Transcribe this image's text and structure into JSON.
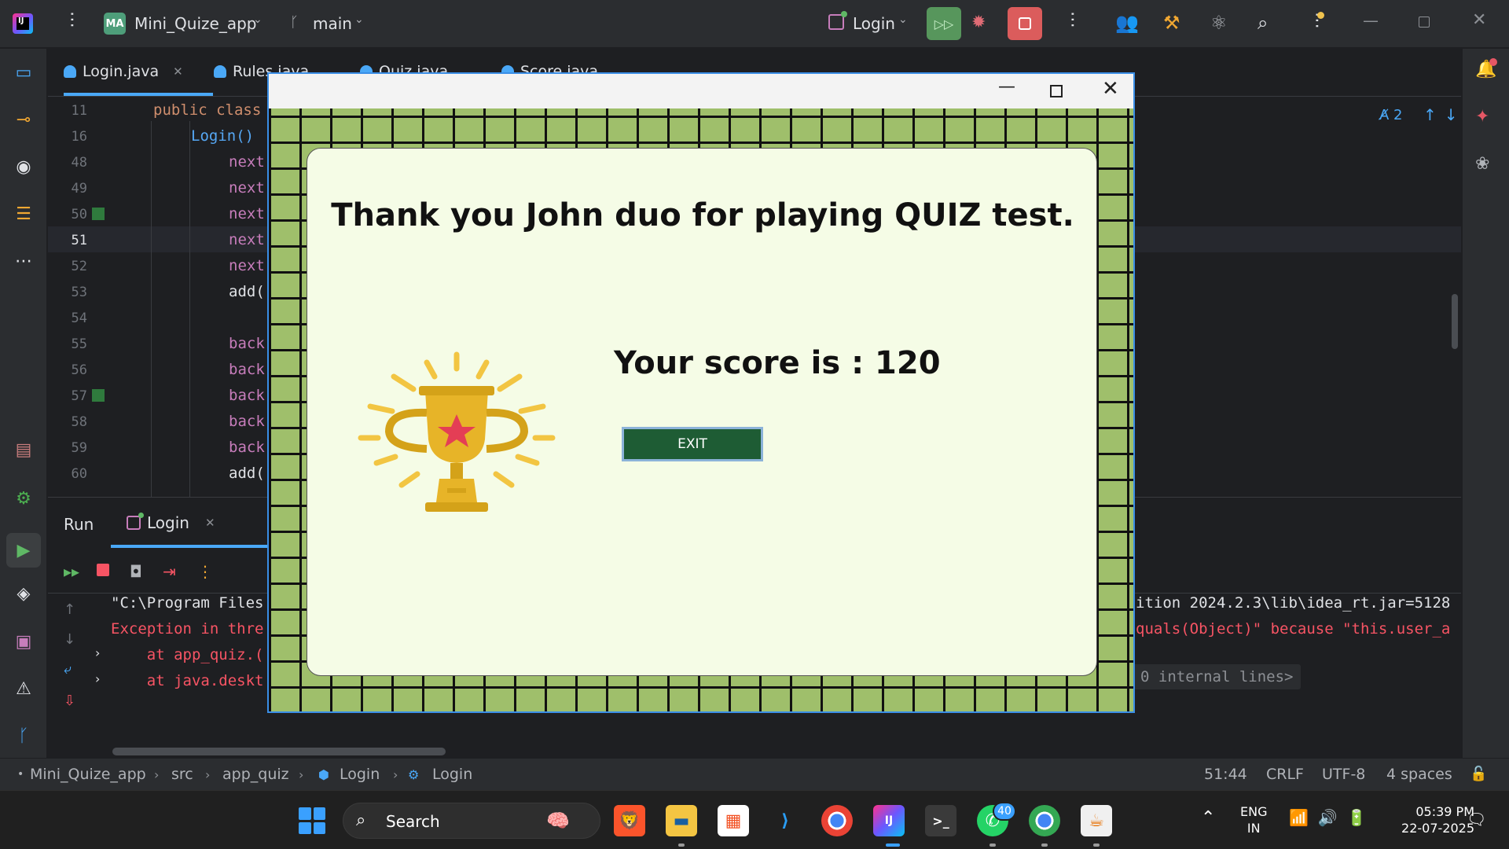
{
  "titlebar": {
    "app_logo": "IJ",
    "project_badge": "MA",
    "project_name": "Mini_Quize_app",
    "branch": "main",
    "run_config": "Login",
    "icons": [
      "hamburger-icon",
      "branch-icon",
      "rerun-icon",
      "debug-icon",
      "stop-icon",
      "collab-icon",
      "build-icon",
      "atom-icon",
      "search-icon",
      "settings-icon"
    ]
  },
  "editor_tabs": [
    {
      "label": "Login.java",
      "active": true
    },
    {
      "label": "Rules.java"
    },
    {
      "label": "Quiz.java"
    },
    {
      "label": "Score.java"
    }
  ],
  "editor": {
    "inspection_count": "2",
    "lines": [
      {
        "n": "11",
        "code": "public class"
      },
      {
        "n": "16",
        "code": "Login()"
      },
      {
        "n": "48",
        "code": "next"
      },
      {
        "n": "49",
        "code": "next"
      },
      {
        "n": "50",
        "code": "next"
      },
      {
        "n": "51",
        "code": "next"
      },
      {
        "n": "52",
        "code": "next"
      },
      {
        "n": "53",
        "code": "add("
      },
      {
        "n": "54",
        "code": ""
      },
      {
        "n": "55",
        "code": "back"
      },
      {
        "n": "56",
        "code": "back"
      },
      {
        "n": "57",
        "code": "back"
      },
      {
        "n": "58",
        "code": "back"
      },
      {
        "n": "59",
        "code": "back"
      },
      {
        "n": "60",
        "code": "add("
      }
    ]
  },
  "run_panel": {
    "title": "Run",
    "tab": "Login",
    "console": {
      "l1_left": "\"C:\\Program Files",
      "l1_right": "ition 2024.2.3\\lib\\idea_rt.jar=5128",
      "l2_left": "Exception in thre",
      "l2_right": "quals(Object)\" because \"this.user_a",
      "l3_left": "    at app_quiz.(",
      "l4_left": "    at java.deskt",
      "l4_right": "0 internal lines>"
    }
  },
  "statusbar": {
    "breadcrumbs": [
      "Mini_Quize_app",
      "src",
      "app_quiz",
      "Login",
      "Login"
    ],
    "position": "51:44",
    "line_sep": "CRLF",
    "encoding": "UTF-8",
    "indent": "4 spaces"
  },
  "quiz_window": {
    "thanks_text": "Thank you John duo for playing QUIZ test.",
    "score_text": "Your score is : 120",
    "exit_label": "EXIT",
    "colors": {
      "grid_bg": "#9fbf6b",
      "panel": "#f5fce6",
      "button": "#1e5c34"
    }
  },
  "taskbar": {
    "search_label": "Search",
    "whatsapp_badge": "40",
    "lang_line1": "ENG",
    "lang_line2": "IN",
    "time": "05:39 PM",
    "date": "22-07-2025"
  }
}
